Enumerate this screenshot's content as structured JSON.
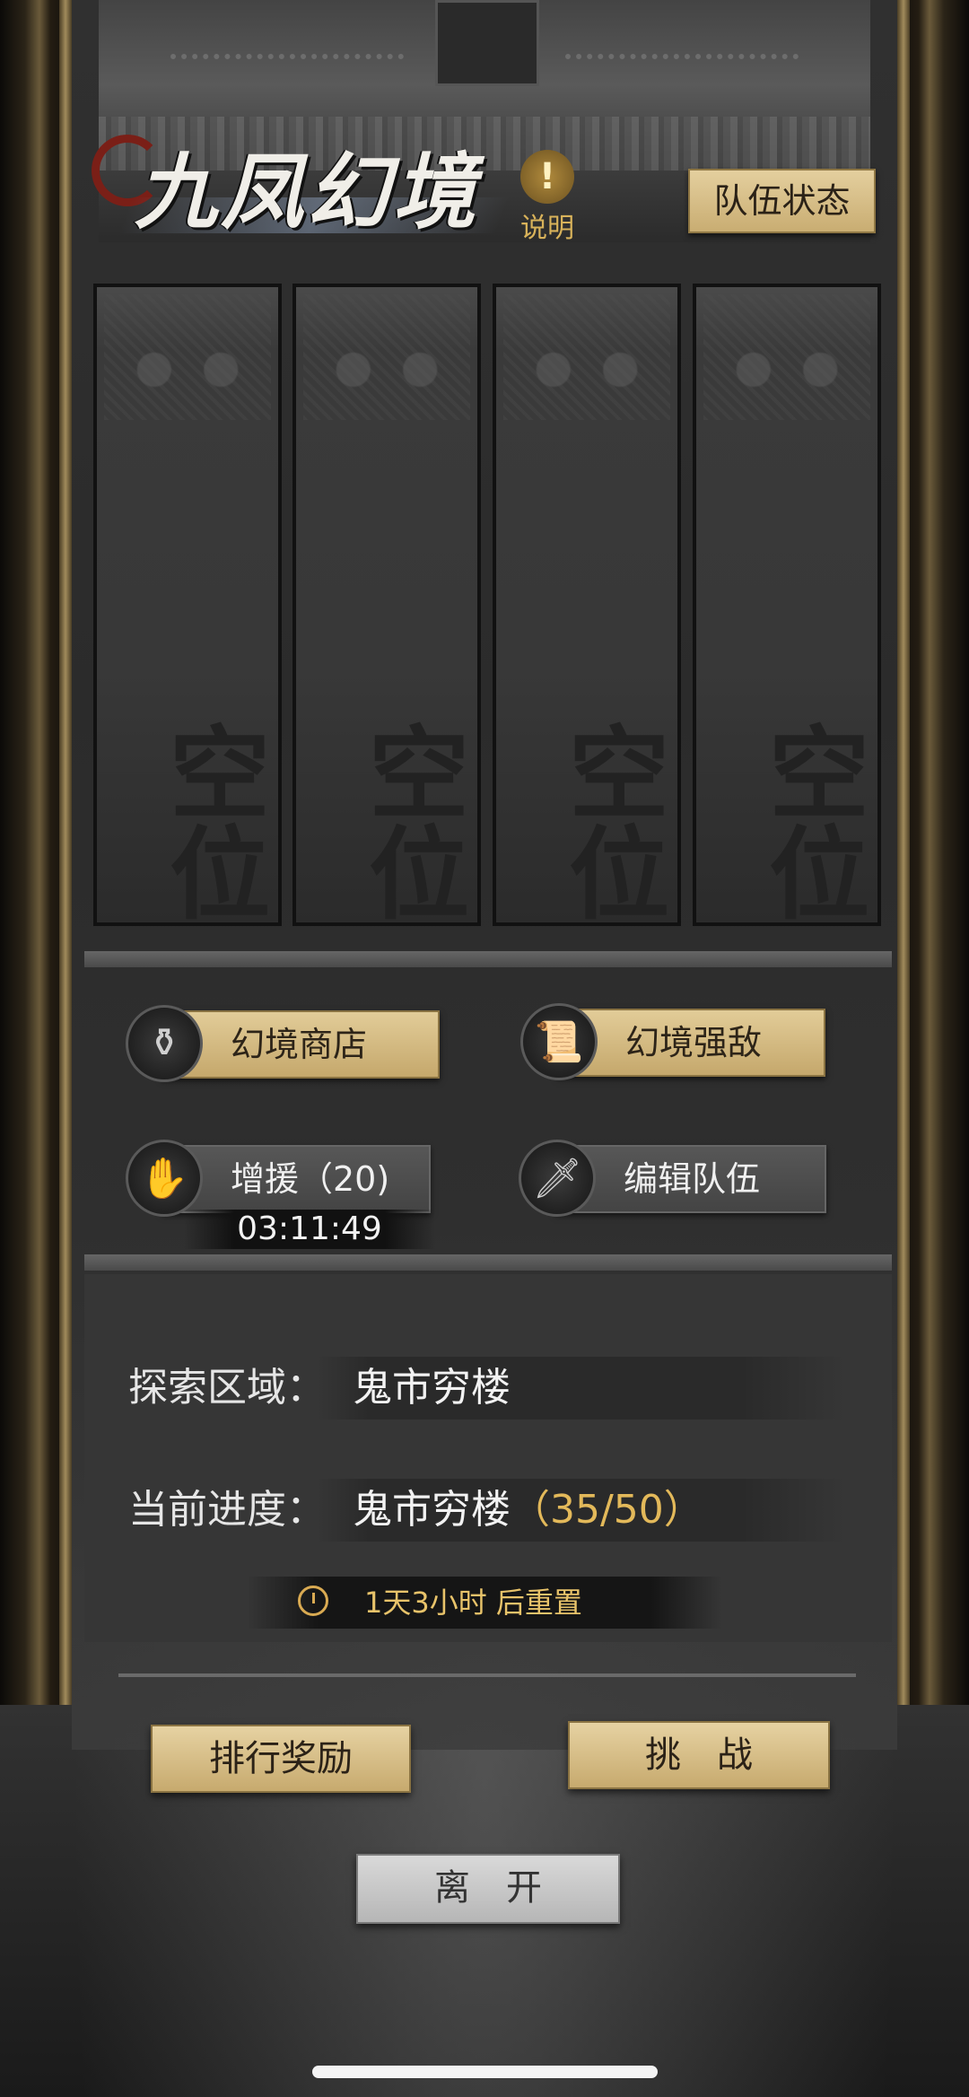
{
  "header": {
    "title": "九凤幻境",
    "explain_label": "说明",
    "explain_icon": "!",
    "team_status_label": "队伍状态"
  },
  "slots": [
    {
      "label": "空位"
    },
    {
      "label": "空位"
    },
    {
      "label": "空位"
    },
    {
      "label": "空位"
    }
  ],
  "actions": {
    "shop": {
      "label": "幻境商店",
      "icon": "bag-icon"
    },
    "boss": {
      "label": "幻境强敌",
      "icon": "book-icon"
    },
    "reinforce": {
      "label": "增援（20)",
      "icon": "hands-icon",
      "timer": "03:11:49"
    },
    "edit_team": {
      "label": "编辑队伍",
      "icon": "dagger-icon"
    }
  },
  "info": {
    "area_key": "探索区域：",
    "area_value": "鬼市穷楼",
    "progress_key": "当前进度：",
    "progress_area": "鬼市穷楼",
    "progress_value": "（35/50）",
    "reset_text": "1天3小时 后重置"
  },
  "buttons": {
    "rank_reward": "排行奖励",
    "challenge": "挑　战",
    "leave": "离　开"
  },
  "colors": {
    "gold_button": "#d6bd85",
    "progress_highlight": "#e3b95a",
    "reset_text": "#e8c36a"
  }
}
